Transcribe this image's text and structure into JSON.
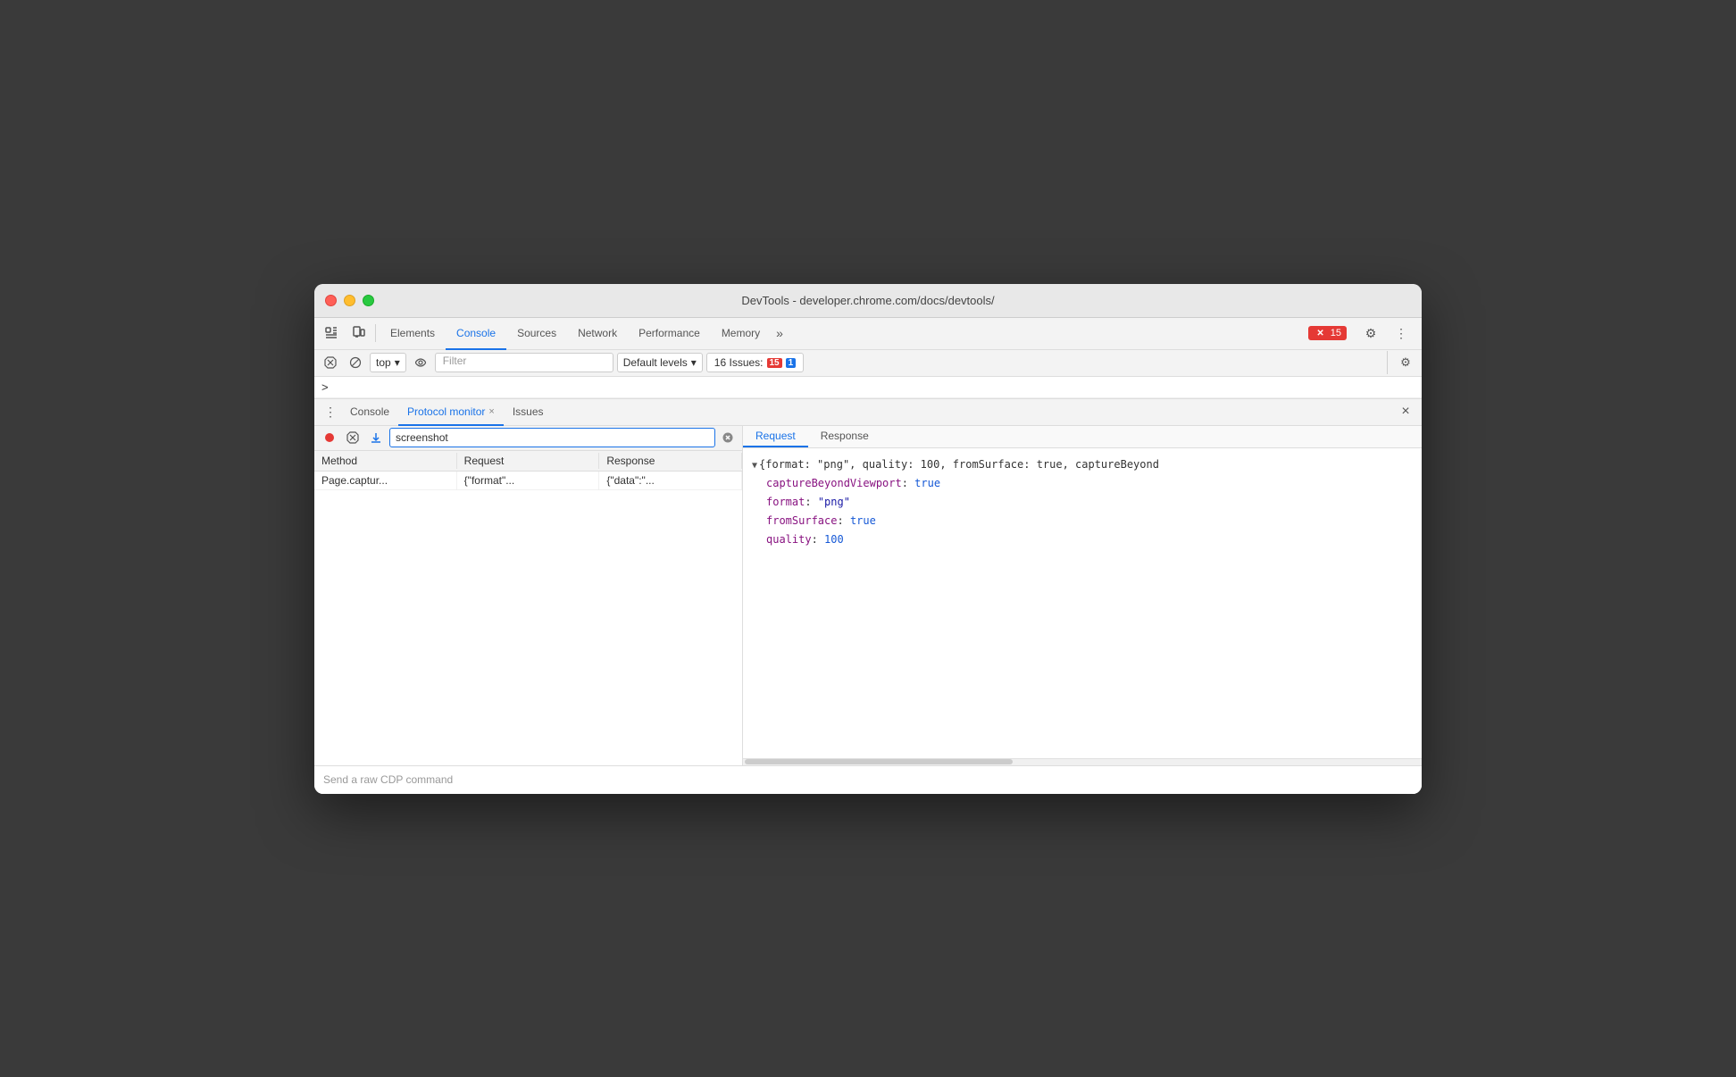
{
  "window": {
    "title": "DevTools - developer.chrome.com/docs/devtools/"
  },
  "tabs": {
    "items": [
      {
        "label": "Elements",
        "active": false
      },
      {
        "label": "Console",
        "active": true
      },
      {
        "label": "Sources",
        "active": false
      },
      {
        "label": "Network",
        "active": false
      },
      {
        "label": "Performance",
        "active": false
      },
      {
        "label": "Memory",
        "active": false
      }
    ],
    "more_icon": "»",
    "error_count": "15",
    "settings_icon": "⚙",
    "three_dots_icon": "⋮"
  },
  "console_toolbar": {
    "top_label": "top",
    "filter_placeholder": "Filter",
    "default_levels_label": "Default levels",
    "issues_label": "16 Issues:",
    "error_count": "15",
    "info_count": "1"
  },
  "caret": {
    "symbol": ">"
  },
  "drawer": {
    "tabs": [
      {
        "label": "Console",
        "active": false,
        "closeable": false
      },
      {
        "label": "Protocol monitor",
        "active": true,
        "closeable": true
      },
      {
        "label": "Issues",
        "active": false,
        "closeable": false
      }
    ],
    "close_icon": "×"
  },
  "protocol_monitor": {
    "search_value": "screenshot",
    "table": {
      "headers": [
        "Method",
        "Request",
        "Response"
      ],
      "rows": [
        {
          "method": "Page.captur...",
          "request": "{\"format\"...",
          "response": "{\"data\":\"..."
        }
      ]
    },
    "detail": {
      "tabs": [
        "Request",
        "Response"
      ],
      "active_tab": "Request",
      "content_line1": "{format: \"png\", quality: 100, fromSurface: true, captureBeyond",
      "properties": [
        {
          "key": "captureBeyondViewport",
          "value": "true",
          "type": "bool"
        },
        {
          "key": "format",
          "value": "\"png\"",
          "type": "string"
        },
        {
          "key": "fromSurface",
          "value": "true",
          "type": "bool"
        },
        {
          "key": "quality",
          "value": "100",
          "type": "number"
        }
      ]
    }
  },
  "cdp_input": {
    "placeholder": "Send a raw CDP command"
  }
}
